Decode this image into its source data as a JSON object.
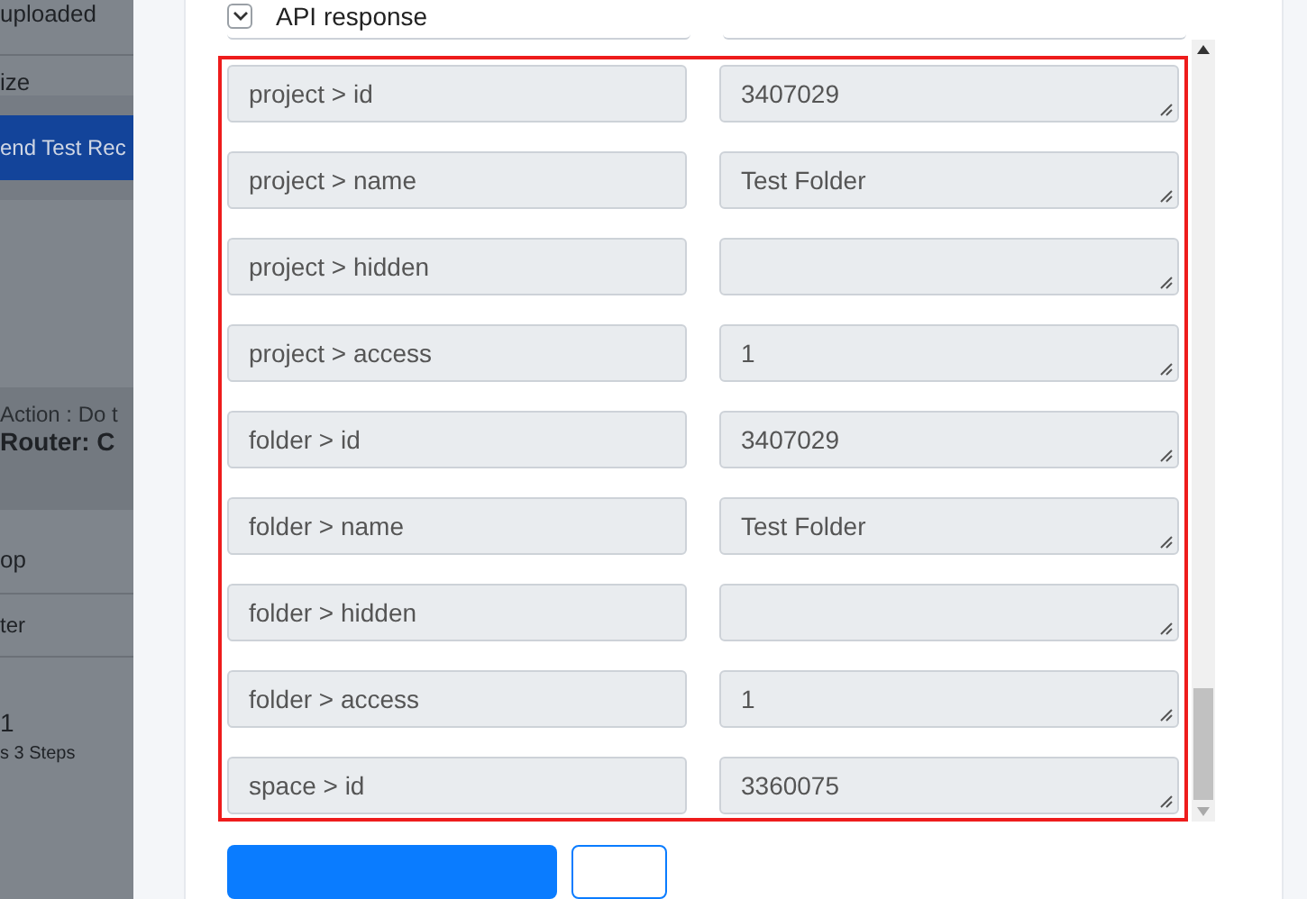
{
  "background_page": {
    "texts": [
      {
        "kind": "plain",
        "text": "uploaded"
      },
      {
        "kind": "plain",
        "text": "ize"
      },
      {
        "kind": "button",
        "text": "end Test Rec"
      },
      {
        "kind": "caption",
        "text": "Action : Do t"
      },
      {
        "kind": "heading",
        "text": "Router: C"
      },
      {
        "kind": "plain",
        "text": "op"
      },
      {
        "kind": "plain",
        "text": "ter"
      },
      {
        "kind": "heading",
        "text": "1"
      },
      {
        "kind": "caption",
        "text": "s 3 Steps"
      }
    ]
  },
  "section": {
    "title": "API response",
    "expanded": true
  },
  "fields": [
    {
      "label": "project > id",
      "value": "3407029"
    },
    {
      "label": "project > name",
      "value": "Test Folder"
    },
    {
      "label": "project > hidden"
    },
    {
      "label": "project > access",
      "value": "1"
    },
    {
      "label": "folder > id",
      "value": "3407029"
    },
    {
      "label": "folder > name",
      "value": "Test Folder"
    },
    {
      "label": "folder > hidden"
    },
    {
      "label": "folder > access",
      "value": "1"
    },
    {
      "label": "space > id",
      "value": "3360075"
    }
  ]
}
